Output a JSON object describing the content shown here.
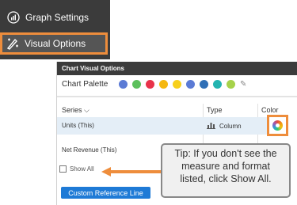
{
  "menu": {
    "graph_settings": "Graph Settings",
    "visual_options": "Visual Options"
  },
  "dialog": {
    "title": "Chart Visual Options",
    "palette_label": "Chart Palette",
    "palette_colors": [
      "#5b7bd5",
      "#5cc05c",
      "#e8334a",
      "#f5b80f",
      "#f7d01b",
      "#5b7bd5",
      "#2f6fb6",
      "#23b4b0",
      "#a6d24a"
    ],
    "columns": {
      "series": "Series",
      "type": "Type",
      "color": "Color"
    },
    "rows": [
      {
        "series": "Units (This)",
        "type": "Column"
      },
      {
        "series": "Net Revenue (This)"
      }
    ],
    "show_all": "Show All",
    "custom_reference_line": "Custom Reference Line"
  },
  "tip": {
    "lines": [
      "Tip: If you don't see the",
      "measure and format",
      "listed, click Show All."
    ]
  },
  "colors": {
    "menu_bg": "#3b3b3b",
    "highlight": "#ee8d3c",
    "button_blue": "#1e7ad6",
    "selected_row": "#e4eef7"
  }
}
